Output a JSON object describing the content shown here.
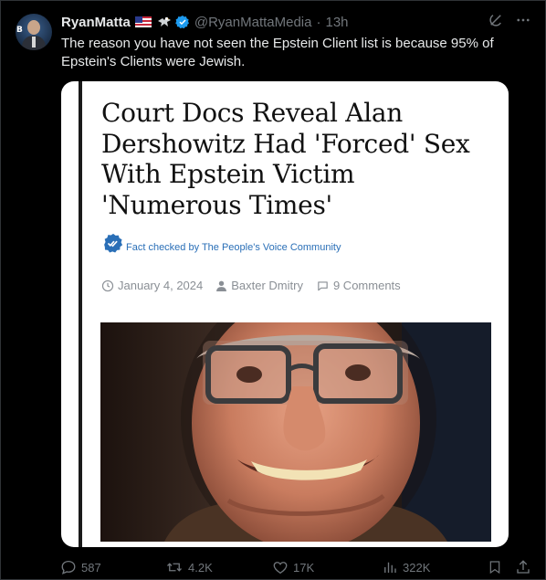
{
  "tweet": {
    "display_name": "RyanMatta",
    "handle": "@RyanMattaMedia",
    "separator": "·",
    "time": "13h",
    "text": "The reason you have not seen the Epstein Client list is because 95% of Epstein's Clients were Jewish.",
    "avatar_letter": "B"
  },
  "card": {
    "headline": "Court Docs Reveal Alan Dershowitz Had 'Forced' Sex With Epstein Victim 'Numerous Times'",
    "fact_check": "Fact checked by The People's Voice Community",
    "date": "January 4, 2024",
    "author": "Baxter Dmitry",
    "comments": "9 Comments"
  },
  "actions": {
    "replies": "587",
    "reposts": "4.2K",
    "likes": "17K",
    "views": "322K"
  },
  "colors": {
    "background": "#000000",
    "text": "#e7e9ea",
    "muted": "#71767b",
    "verified": "#1d9bf0",
    "fact_check_blue": "#2a6fb7"
  },
  "icons": [
    "flag-us-icon",
    "eagle-icon",
    "verified-badge-icon",
    "grok-icon",
    "more-icon",
    "fact-check-icon",
    "clock-icon",
    "user-icon",
    "comment-icon",
    "reply-icon",
    "repost-icon",
    "like-icon",
    "views-icon",
    "bookmark-icon",
    "share-icon"
  ]
}
